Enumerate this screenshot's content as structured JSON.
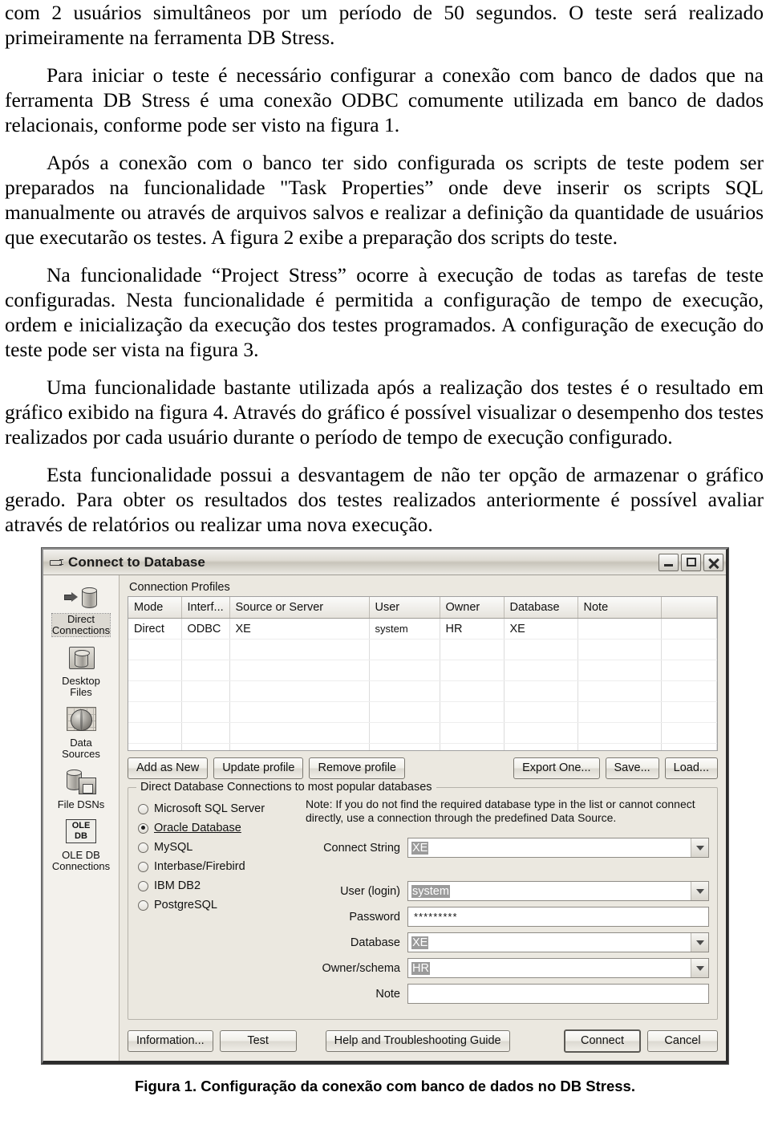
{
  "document": {
    "paragraphs": [
      "com 2 usuários simultâneos por um período de 50 segundos. O teste será realizado primeiramente na ferramenta DB Stress.",
      "Para iniciar o teste é necessário configurar a conexão com banco de dados que na ferramenta DB Stress é uma conexão ODBC comumente utilizada em banco de dados relacionais, conforme pode ser visto na figura 1.",
      "Após a conexão com o banco ter sido configurada os scripts de teste podem ser preparados na funcionalidade \"Task Properties” onde deve inserir os scripts SQL manualmente ou através de arquivos salvos e realizar a definição da quantidade de usuários que executarão os testes. A figura 2 exibe a preparação dos scripts do teste.",
      "Na funcionalidade “Project Stress” ocorre à execução de todas as tarefas de teste configuradas. Nesta funcionalidade é permitida a configuração de tempo de execução, ordem e inicialização da execução dos testes programados. A configuração de execução do teste pode ser vista na figura 3.",
      "Uma funcionalidade bastante utilizada após a realização dos testes é o resultado em gráfico exibido na figura 4. Através do gráfico é possível visualizar o desempenho dos testes realizados por cada usuário durante o período de tempo de execução configurado.",
      "Esta funcionalidade possui a desvantagem de não ter opção de armazenar o gráfico gerado. Para obter os resultados dos testes realizados anteriormente é possível avaliar através de relatórios ou realizar uma nova execução."
    ],
    "figure_caption": "Figura 1. Configuração da conexão com banco de dados no DB Stress."
  },
  "dialog": {
    "title": "Connect to Database",
    "title_icon": "plug-icon",
    "window_controls": [
      {
        "name": "minimize-button",
        "glyph": "minimize-icon"
      },
      {
        "name": "maximize-button",
        "glyph": "maximize-icon"
      },
      {
        "name": "close-button",
        "glyph": "close-icon"
      }
    ],
    "sidebar": {
      "items": [
        {
          "label": "Direct\nConnections",
          "icon": "direct-connection-icon",
          "selected": true
        },
        {
          "label": "Desktop\nFiles",
          "icon": "folder-database-icon",
          "selected": false
        },
        {
          "label": "Data\nSources",
          "icon": "globe-grid-icon",
          "selected": false
        },
        {
          "label": "File DSNs",
          "icon": "database-disk-icon",
          "selected": false
        },
        {
          "label": "OLE DB\nConnections",
          "icon": "ole-db-icon",
          "selected": false
        }
      ]
    },
    "profiles": {
      "section_label": "Connection Profiles",
      "columns": [
        "Mode",
        "Interf...",
        "Source or Server",
        "User",
        "Owner",
        "Database",
        "Note",
        ""
      ],
      "rows": [
        [
          "Direct",
          "ODBC",
          "XE",
          "system",
          "HR",
          "XE",
          "",
          ""
        ]
      ]
    },
    "profile_buttons": {
      "left": [
        "Add as New",
        "Update profile",
        "Remove profile"
      ],
      "right": [
        "Export One...",
        "Save...",
        "Load..."
      ]
    },
    "group": {
      "title": "Direct Database Connections to most popular databases",
      "radios": [
        {
          "label": "Microsoft SQL Server",
          "checked": false
        },
        {
          "label": "Oracle Database",
          "checked": true
        },
        {
          "label": "MySQL",
          "checked": false
        },
        {
          "label": "Interbase/Firebird",
          "checked": false
        },
        {
          "label": "IBM DB2",
          "checked": false
        },
        {
          "label": "PostgreSQL",
          "checked": false
        }
      ],
      "note": "Note: If you do not find the required database type in the list or cannot connect directly, use a connection through the predefined Data Source.",
      "fields": [
        {
          "label": "Connect String",
          "value": "XE",
          "selected": true,
          "dropdown": true,
          "password": false
        },
        {
          "label": "User (login)",
          "value": "system",
          "selected": true,
          "dropdown": true,
          "password": false
        },
        {
          "label": "Password",
          "value": "*********",
          "selected": false,
          "dropdown": false,
          "password": true
        },
        {
          "label": "Database",
          "value": "XE",
          "selected": true,
          "dropdown": true,
          "password": false
        },
        {
          "label": "Owner/schema",
          "value": "HR",
          "selected": true,
          "dropdown": true,
          "password": false
        },
        {
          "label": "Note",
          "value": "",
          "selected": false,
          "dropdown": false,
          "password": false
        }
      ]
    },
    "footer_buttons": [
      {
        "label": "Information...",
        "default": false
      },
      {
        "label": "Test",
        "default": false
      },
      {
        "label": "Help and Troubleshooting Guide",
        "default": false
      },
      {
        "label": "Connect",
        "default": true
      },
      {
        "label": "Cancel",
        "default": false
      }
    ]
  }
}
